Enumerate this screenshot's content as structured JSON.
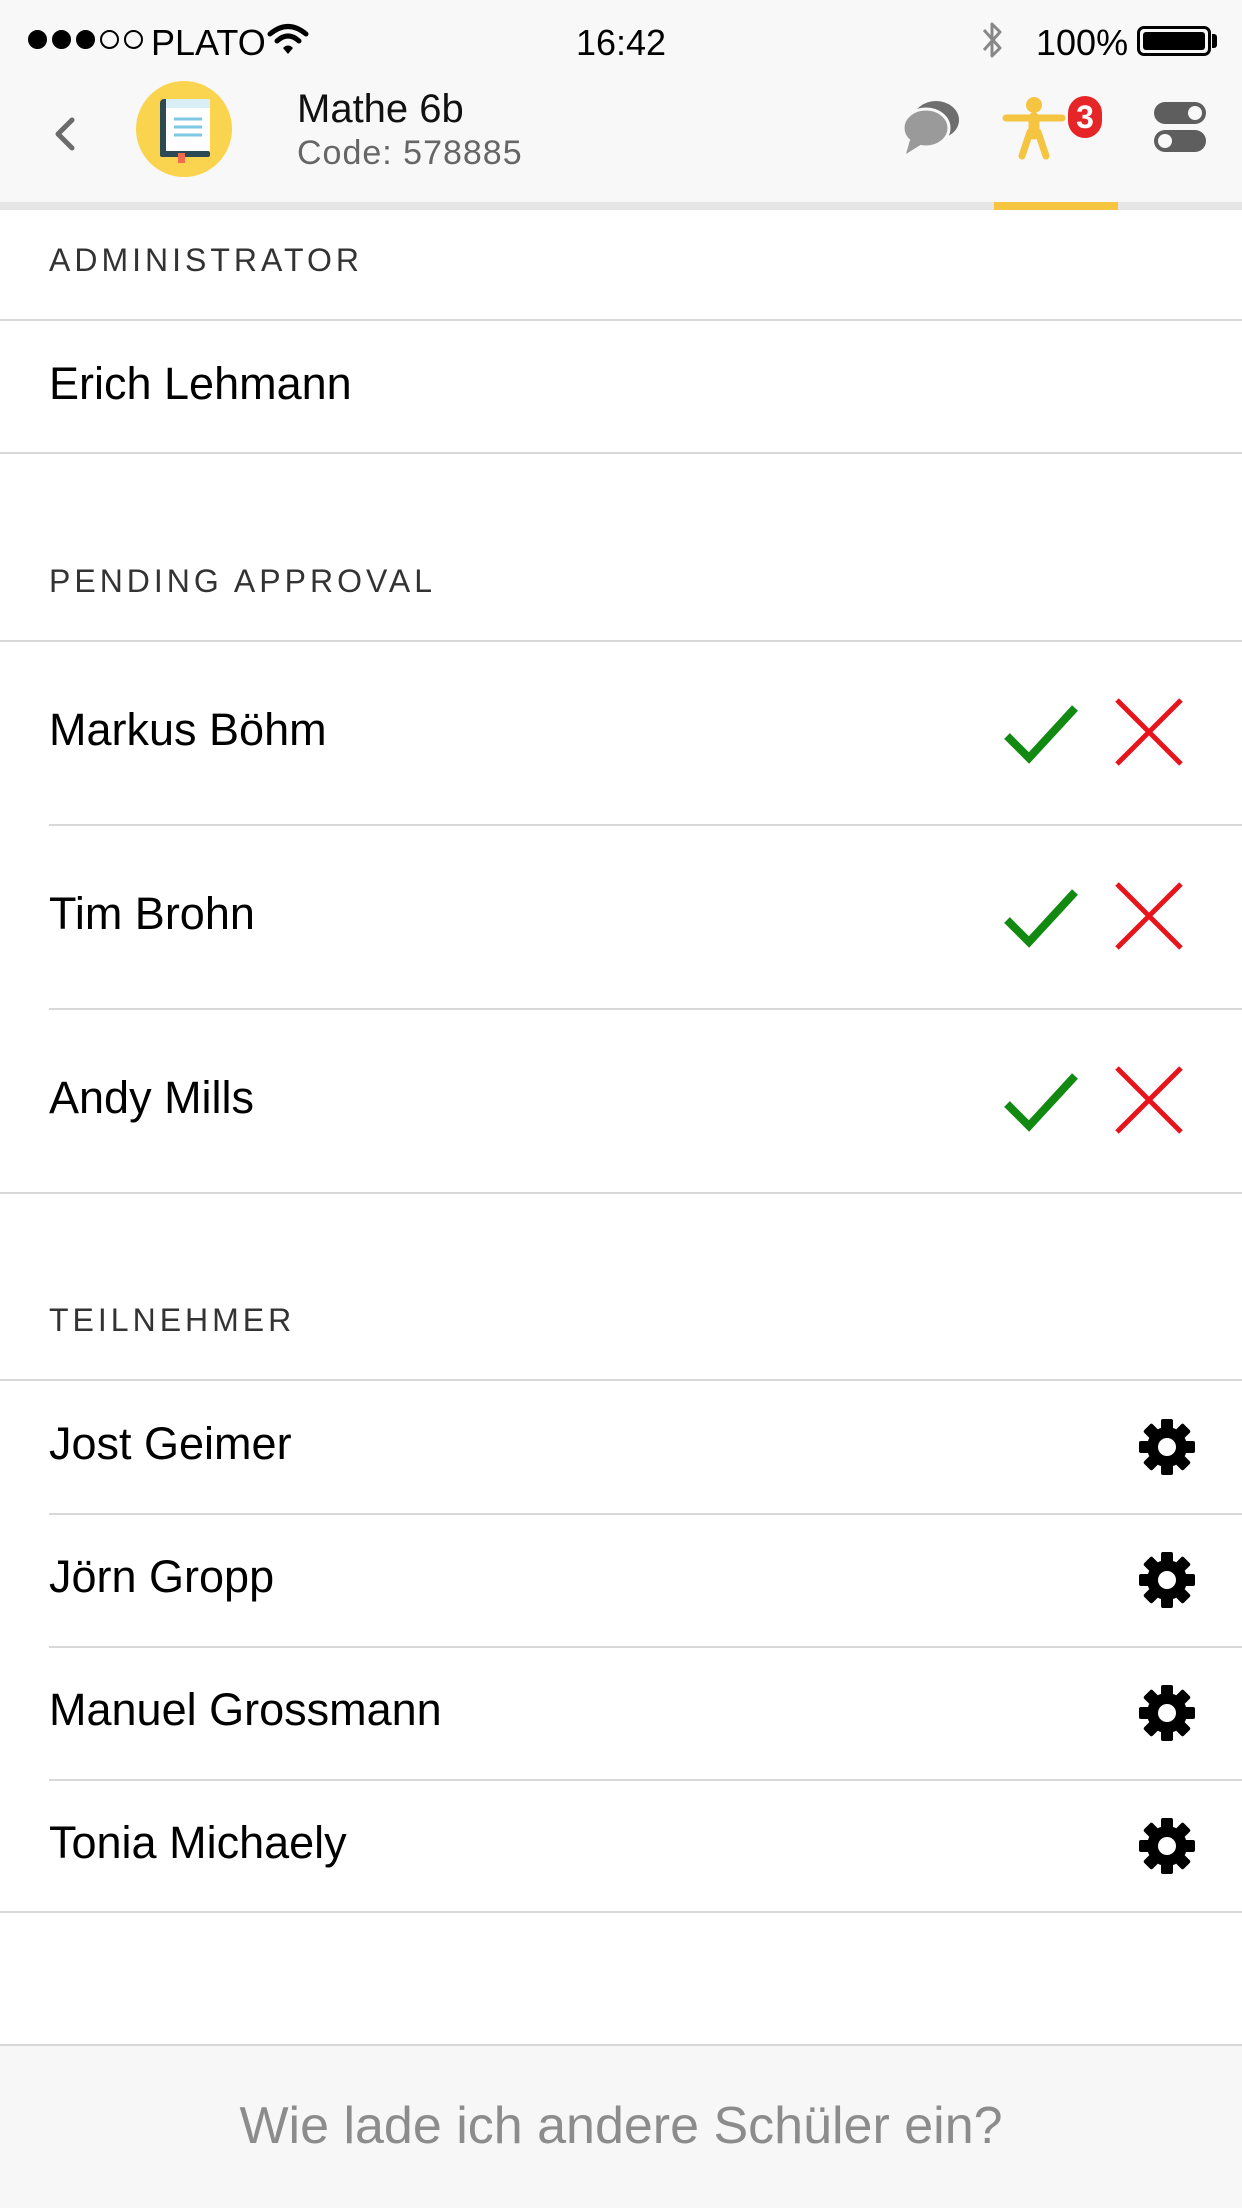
{
  "status_bar": {
    "carrier": "PLATO",
    "time": "16:42",
    "battery": "100%",
    "signal_bars_filled": 3,
    "signal_bars_total": 5
  },
  "header": {
    "title": "Mathe 6b",
    "code": "Code: 578885",
    "badge_count": "3",
    "accent_color": "#f5c542"
  },
  "sections": {
    "administrator": {
      "heading": "ADMINISTRATOR",
      "members": [
        "Erich Lehmann"
      ]
    },
    "pending": {
      "heading": "PENDING APPROVAL",
      "members": [
        "Markus Böhm",
        "Tim Brohn",
        "Andy Mills"
      ]
    },
    "participants": {
      "heading": "TEILNEHMER",
      "members": [
        "Jost Geimer",
        "Jörn Gropp",
        "Manuel Grossmann",
        "Tonia Michaely"
      ]
    }
  },
  "footer": {
    "link": "Wie lade ich andere Schüler ein?"
  },
  "icons": {
    "back": "chevron-left-icon",
    "chat": "chat-bubbles-icon",
    "participants": "person-icon",
    "settings": "toggle-icon",
    "approve": "checkmark-icon",
    "reject": "cross-icon",
    "member_settings": "gear-icon"
  },
  "colors": {
    "approve": "#128a12",
    "reject": "#e8141c",
    "badge": "#e52528",
    "avatar": "#fad34f"
  }
}
